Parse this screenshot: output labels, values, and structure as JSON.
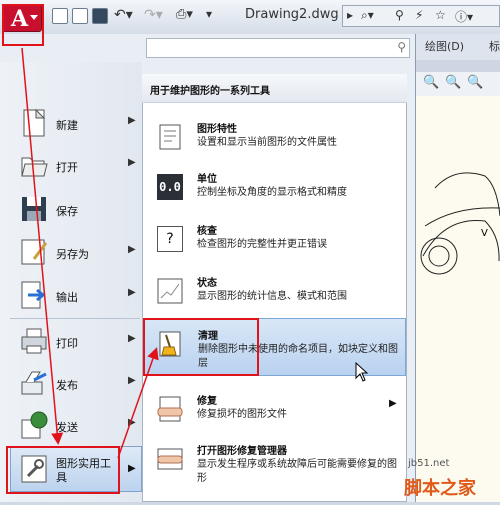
{
  "app": {
    "title": "Drawing2.dwg",
    "logo_letter": "A"
  },
  "ribbon": {
    "tab_draw": "绘图(D)",
    "tab_more": "标"
  },
  "search": {
    "placeholder": ""
  },
  "left_menu": {
    "items": [
      {
        "label": "新建"
      },
      {
        "label": "打开"
      },
      {
        "label": "保存"
      },
      {
        "label": "另存为"
      },
      {
        "label": "输出"
      },
      {
        "label": "打印"
      },
      {
        "label": "发布"
      },
      {
        "label": "发送"
      },
      {
        "label": "图形实用工具"
      }
    ],
    "util_line1": "图形实用工",
    "util_line2": "具"
  },
  "submenu": {
    "header": "用于维护图形的一系列工具",
    "items": [
      {
        "title": "图形特性",
        "desc": "设置和显示当前图形的文件属性"
      },
      {
        "title": "单位",
        "desc": "控制坐标及角度的显示格式和精度",
        "icon_text": "0.0"
      },
      {
        "title": "核查",
        "desc": "检查图形的完整性并更正错误",
        "icon_text": "?"
      },
      {
        "title": "状态",
        "desc": "显示图形的统计信息、模式和范围"
      },
      {
        "title": "清理",
        "desc": "删除图形中未使用的命名项目，如块定义和图层"
      },
      {
        "title": "修复",
        "desc": "修复损坏的图形文件"
      },
      {
        "title": "打开图形修复管理器",
        "desc": "显示发生程序或系统故障后可能需要修复的图形"
      }
    ]
  },
  "watermark": {
    "site": "jb51.net",
    "cn": "脚本之家"
  },
  "colors": {
    "accent_red": "#e0131b",
    "logo_red": "#c8102e",
    "highlight": "#bcd3ee"
  }
}
